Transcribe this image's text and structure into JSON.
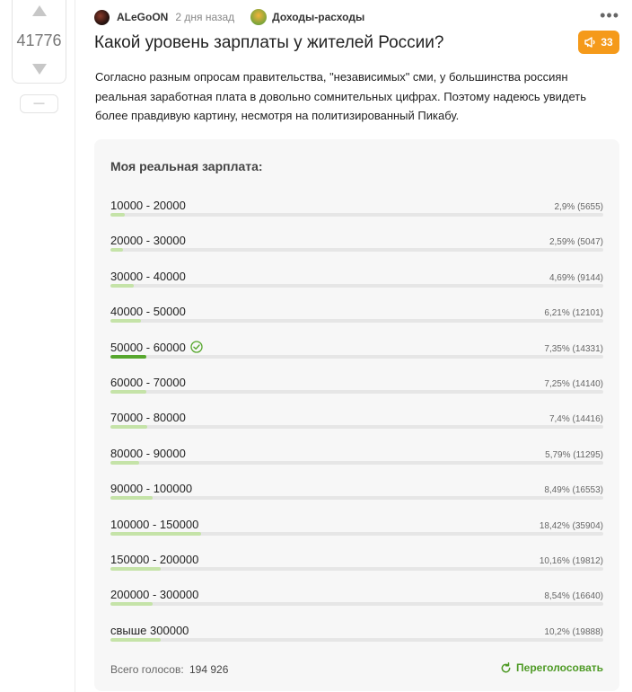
{
  "rating": {
    "value": "41776",
    "minus_label": "—"
  },
  "post": {
    "author": "ALeGoON",
    "time": "2 дня назад",
    "community": "Доходы-расходы",
    "title": "Какой уровень зарплаты у жителей России?",
    "badge_count": "33",
    "text": "Согласно разным опросам правительства, \"независимых\" сми, у большинства россиян реальная заработная плата в довольно сомнительных цифрах. Поэтому надеюсь увидеть более правдивую картину, несмотря на политизированный Пикабу."
  },
  "poll": {
    "title": "Моя реальная зарплата:",
    "options": [
      {
        "label": "10000 - 20000",
        "percent": 2.9,
        "stat": "2,9% (5655)"
      },
      {
        "label": "20000 - 30000",
        "percent": 2.59,
        "stat": "2,59% (5047)"
      },
      {
        "label": "30000 - 40000",
        "percent": 4.69,
        "stat": "4,69% (9144)"
      },
      {
        "label": "40000 - 50000",
        "percent": 6.21,
        "stat": "6,21% (12101)"
      },
      {
        "label": "50000 - 60000",
        "percent": 7.35,
        "stat": "7,35% (14331)",
        "voted": true
      },
      {
        "label": "60000 - 70000",
        "percent": 7.25,
        "stat": "7,25% (14140)"
      },
      {
        "label": "70000 - 80000",
        "percent": 7.4,
        "stat": "7,4% (14416)"
      },
      {
        "label": "80000 - 90000",
        "percent": 5.79,
        "stat": "5,79% (11295)"
      },
      {
        "label": "90000 - 100000",
        "percent": 8.49,
        "stat": "8,49% (16553)"
      },
      {
        "label": "100000 - 150000",
        "percent": 18.42,
        "stat": "18,42% (35904)"
      },
      {
        "label": "150000 - 200000",
        "percent": 10.16,
        "stat": "10,16% (19812)"
      },
      {
        "label": "200000 - 300000",
        "percent": 8.54,
        "stat": "8,54% (16640)"
      },
      {
        "label": "свыше 300000",
        "percent": 10.2,
        "stat": "10,2% (19888)"
      }
    ],
    "total_label": "Всего голосов:",
    "total_value": "194 926",
    "revote_label": "Переголосовать"
  },
  "colors": {
    "accent": "#f59a1a",
    "bar_fill": "#c5e3a8",
    "bar_voted": "#57a72e",
    "revote": "#4e9a25"
  },
  "icons": [
    "arrow-up-icon",
    "arrow-down-icon",
    "more-icon",
    "megaphone-icon",
    "check-circle-icon",
    "refresh-icon"
  ]
}
